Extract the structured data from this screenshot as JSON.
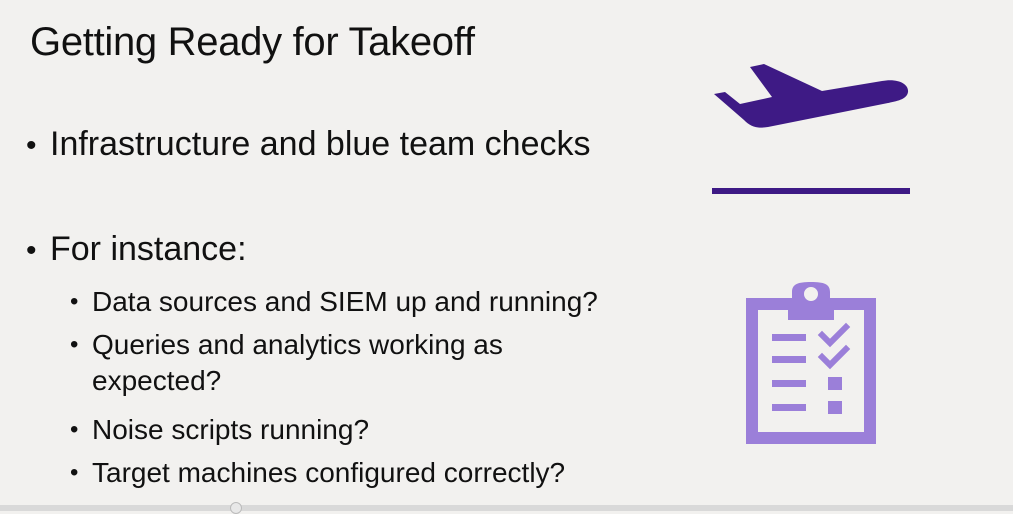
{
  "slide": {
    "title": "Getting Ready for Takeoff",
    "bullets": [
      {
        "text": "Infrastructure and blue team checks"
      },
      {
        "text": "For instance:"
      }
    ],
    "sub_bullets": [
      {
        "line1": "Data sources and SIEM up and running?"
      },
      {
        "line1": "Queries and analytics working as",
        "line2": "expected?"
      },
      {
        "line1": "Noise scripts running?"
      },
      {
        "line1": "Target machines configured correctly?"
      }
    ],
    "bullet_char": "•"
  },
  "icons": {
    "plane": "airplane-takeoff-icon",
    "clipboard": "clipboard-checklist-icon",
    "plane_color": "#3e1a85",
    "clipboard_color": "#9b7fd9"
  },
  "video": {
    "progress": 0.23
  }
}
